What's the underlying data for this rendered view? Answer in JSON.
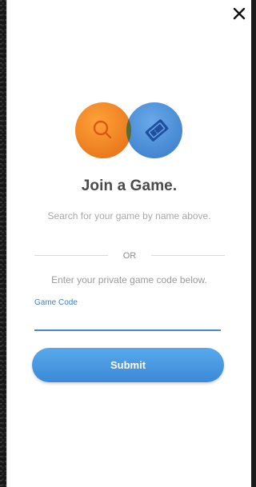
{
  "dialog": {
    "close_label": "✕",
    "title": "Join a Game.",
    "search_hint": "Search for your game by name above.",
    "divider_text": "OR",
    "code_hint": "Enter your private game code below.",
    "code_field": {
      "label": "Game Code",
      "value": "",
      "placeholder": ""
    },
    "submit_label": "Submit"
  },
  "icons": {
    "close": "close-icon",
    "search": "magnifier-icon",
    "ticket": "ticket-icon"
  },
  "colors": {
    "search_circle": "#f28a1e",
    "ticket_circle": "#4a8fd6",
    "overlap": "#5a6a2c",
    "accent": "#3c89d6",
    "title_text": "#4a4a4a"
  }
}
